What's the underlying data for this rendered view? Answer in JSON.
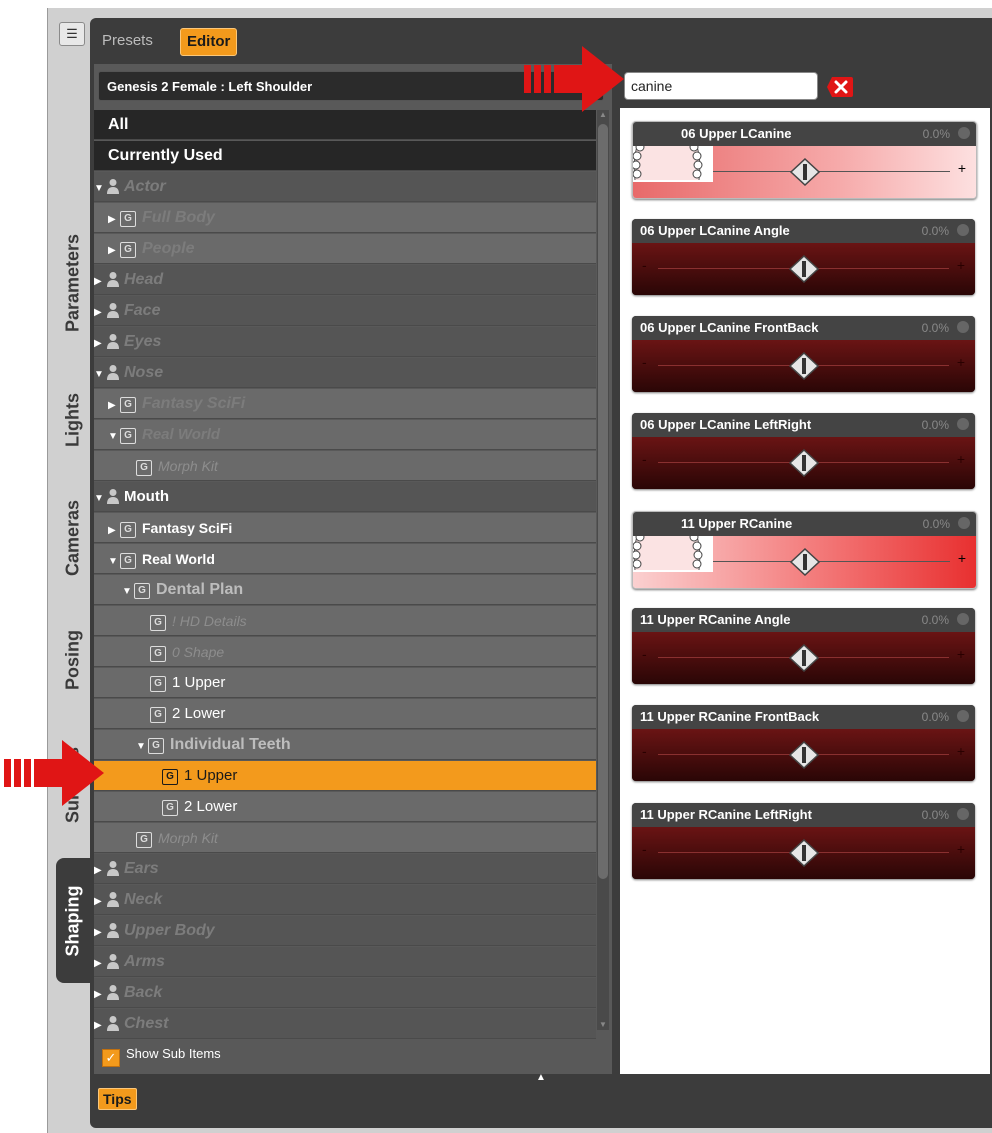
{
  "side_tabs": [
    {
      "label": "Parameters",
      "active": false
    },
    {
      "label": "Lights",
      "active": false
    },
    {
      "label": "Cameras",
      "active": false
    },
    {
      "label": "Posing",
      "active": false
    },
    {
      "label": "Surfaces",
      "active": false
    },
    {
      "label": "Shaping",
      "active": true
    }
  ],
  "header_tabs": {
    "presets": "Presets",
    "editor": "Editor"
  },
  "breadcrumb": "Genesis 2 Female : Left Shoulder",
  "search": {
    "value": "canine"
  },
  "tree": {
    "all": "All",
    "currently_used": "Currently Used",
    "actor": "Actor",
    "full_body": "Full Body",
    "people": "People",
    "head": "Head",
    "face": "Face",
    "eyes": "Eyes",
    "nose": "Nose",
    "nose_fantasy": "Fantasy SciFi",
    "nose_real": "Real World",
    "nose_morph": "Morph Kit",
    "mouth": "Mouth",
    "mouth_fantasy": "Fantasy SciFi",
    "mouth_real": "Real World",
    "dental_plan": "Dental Plan",
    "hd_details": "! HD Details",
    "shape0": "0 Shape",
    "upper1": "1 Upper",
    "lower2": "2 Lower",
    "individual_teeth": "Individual Teeth",
    "it_upper": "1 Upper",
    "it_lower": "2 Lower",
    "mouth_morph": "Morph Kit",
    "ears": "Ears",
    "neck": "Neck",
    "upper_body": "Upper Body",
    "arms": "Arms",
    "back": "Back",
    "chest": "Chest"
  },
  "show_sub_items": "Show Sub Items",
  "tips": "Tips",
  "sliders": [
    {
      "name": "06 Upper LCanine",
      "value": "0.0%",
      "level": 0.5
    },
    {
      "name": "06 Upper LCanine Angle",
      "value": "0.0%",
      "level": 0.5
    },
    {
      "name": "06 Upper LCanine FrontBack",
      "value": "0.0%",
      "level": 0.5
    },
    {
      "name": "06 Upper LCanine LeftRight",
      "value": "0.0%",
      "level": 0.5
    },
    {
      "name": "11 Upper RCanine",
      "value": "0.0%",
      "level": 0.5
    },
    {
      "name": "11 Upper RCanine Angle",
      "value": "0.0%",
      "level": 0.5
    },
    {
      "name": "11 Upper RCanine FrontBack",
      "value": "0.0%",
      "level": 0.5
    },
    {
      "name": "11 Upper RCanine LeftRight",
      "value": "0.0%",
      "level": 0.5
    }
  ],
  "colors": {
    "accent": "#f39a1c",
    "arrow": "#e01515",
    "panel": "#3c3c3c"
  }
}
